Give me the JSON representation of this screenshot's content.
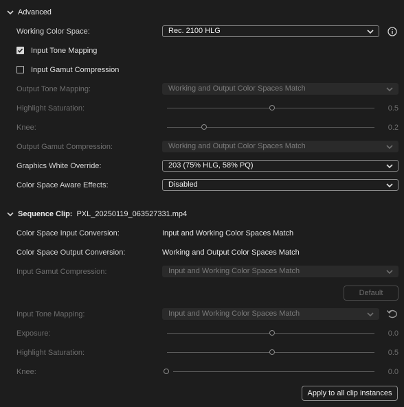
{
  "advanced": {
    "title": "Advanced",
    "working_color_space": {
      "label": "Working Color Space:",
      "value": "Rec. 2100 HLG"
    },
    "input_tone_mapping": {
      "label": "Input Tone Mapping",
      "checked": true
    },
    "input_gamut_compression": {
      "label": "Input Gamut Compression",
      "checked": false
    },
    "output_tone_mapping": {
      "label": "Output Tone Mapping:",
      "value": "Working and Output Color Spaces Match"
    },
    "highlight_saturation": {
      "label": "Highlight Saturation:",
      "value": "0.5",
      "level": 0.5
    },
    "knee": {
      "label": "Knee:",
      "value": "0.2",
      "level": 0.2
    },
    "output_gamut_compression": {
      "label": "Output Gamut Compression:",
      "value": "Working and Output Color Spaces Match"
    },
    "graphics_white_override": {
      "label": "Graphics White Override:",
      "value": "203 (75% HLG, 58% PQ)"
    },
    "color_space_aware_effects": {
      "label": "Color Space Aware Effects:",
      "value": "Disabled"
    }
  },
  "sequence_clip": {
    "title_prefix": "Sequence Clip:",
    "clip_name": "PXL_20250119_063527331.mp4",
    "input_conversion": {
      "label": "Color Space Input Conversion:",
      "value": "Input and Working Color Spaces Match"
    },
    "output_conversion": {
      "label": "Color Space Output Conversion:",
      "value": "Working and Output Color Spaces Match"
    },
    "input_gamut_compression": {
      "label": "Input Gamut Compression:",
      "value": "Input and Working Color Spaces Match"
    },
    "default_button": "Default",
    "input_tone_mapping": {
      "label": "Input Tone Mapping:",
      "value": "Input and Working Color Spaces Match"
    },
    "exposure": {
      "label": "Exposure:",
      "value": "0.0",
      "level": 0.5
    },
    "highlight_saturation": {
      "label": "Highlight Saturation:",
      "value": "0.5",
      "level": 0.5
    },
    "knee": {
      "label": "Knee:",
      "value": "0.0",
      "level": 0.0
    },
    "apply_button": "Apply to all clip instances"
  }
}
